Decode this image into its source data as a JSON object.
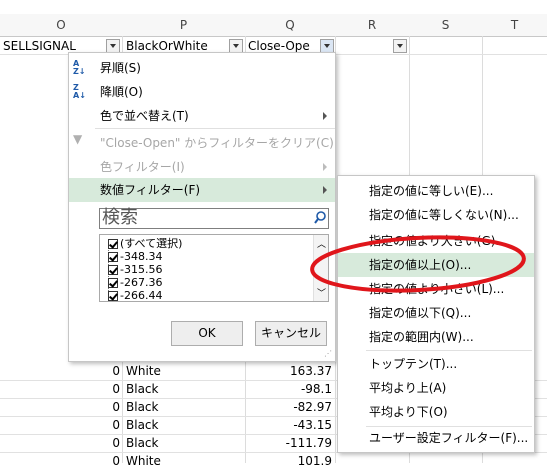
{
  "columns": {
    "o": "O",
    "p": "P",
    "q": "Q",
    "r": "R",
    "s": "S",
    "t": "T"
  },
  "header_row": {
    "o": "SELLSIGNAL",
    "p": "BlackOrWhite",
    "q": "Close-Ope"
  },
  "filter_menu": {
    "sort_asc": "昇順(S)",
    "sort_desc": "降順(O)",
    "sort_by_color": "色で並べ替え(T)",
    "clear_filter": "\"Close-Open\" からフィルターをクリア(C)",
    "color_filter": "色フィルター(I)",
    "number_filter": "数値フィルター(F)",
    "search_placeholder": "検索",
    "list_items": [
      "(すべて選択)",
      "-348.34",
      "-315.56",
      "-267.36",
      "-266.44"
    ],
    "ok": "OK",
    "cancel": "キャンセル"
  },
  "number_filter_submenu": {
    "items": [
      "指定の値に等しい(E)...",
      "指定の値に等しくない(N)...",
      "指定の値より大きい(G)...",
      "指定の値以上(O)...",
      "指定の値より小さい(L)...",
      "指定の値以下(Q)...",
      "指定の範囲内(W)...",
      "トップテン(T)...",
      "平均より上(A)",
      "平均より下(O)",
      "ユーザー設定フィルター(F)..."
    ],
    "highlighted_index": 3
  },
  "rows": [
    {
      "o": "0",
      "p": "White",
      "q": "163.37"
    },
    {
      "o": "0",
      "p": "Black",
      "q": "-98.1"
    },
    {
      "o": "0",
      "p": "Black",
      "q": "-82.97"
    },
    {
      "o": "0",
      "p": "Black",
      "q": "-43.15"
    },
    {
      "o": "0",
      "p": "Black",
      "q": "-111.79"
    },
    {
      "o": "0",
      "p": "White",
      "q": "101.9"
    }
  ],
  "colors": {
    "highlight": "#d7eadb",
    "annotation": "#e0161b"
  }
}
